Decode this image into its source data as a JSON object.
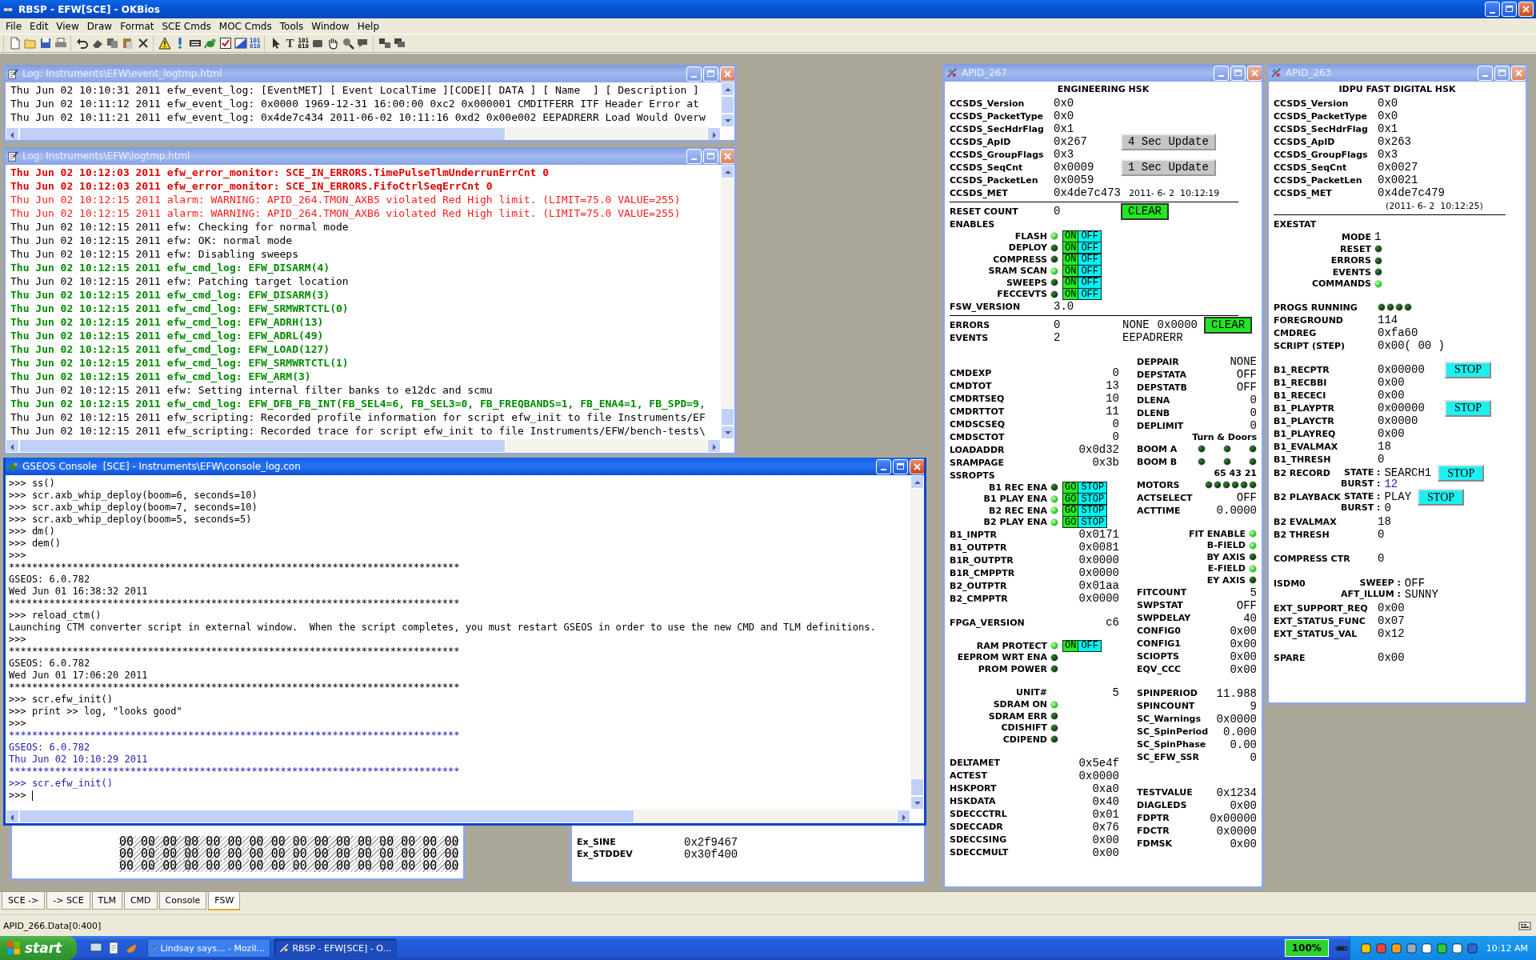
{
  "app_window": {
    "title": "RBSP - EFW[SCE] - OKBios"
  },
  "menu": [
    "File",
    "Edit",
    "View",
    "Draw",
    "Format",
    "SCE Cmds",
    "MOC Cmds",
    "Tools",
    "Window",
    "Help"
  ],
  "toolbar": [
    [
      {
        "kind": "new"
      },
      {
        "kind": "open"
      },
      {
        "kind": "save"
      },
      {
        "kind": "print"
      }
    ],
    [
      {
        "kind": "undo"
      },
      {
        "kind": "eraser"
      },
      {
        "kind": "copy"
      },
      {
        "kind": "paste"
      },
      {
        "kind": "delete"
      }
    ],
    [
      {
        "kind": "warning"
      },
      {
        "kind": "info"
      },
      {
        "kind": "keyboard"
      },
      {
        "kind": "lizard"
      },
      {
        "kind": "checkbox"
      },
      {
        "kind": "chart"
      },
      {
        "kind": "binary_color",
        "label": "101\n010"
      }
    ],
    [
      {
        "kind": "pointer"
      },
      {
        "kind": "text",
        "label": "T"
      },
      {
        "kind": "binary",
        "label": "101\n010"
      },
      {
        "kind": "rectangle"
      },
      {
        "kind": "hand"
      },
      {
        "kind": "zoom"
      },
      {
        "kind": "speech"
      }
    ],
    [
      {
        "kind": "tile"
      },
      {
        "kind": "cascade"
      }
    ]
  ],
  "windows": [
    {
      "kind": "log",
      "title": "Log: Instruments\\EFW\\event_logtmp.html",
      "active": false,
      "lines": [
        {
          "kind": "info",
          "text": "Thu Jun 02 10:10:31 2011 efw_event_log: [EventMET] [ Event LocalTime ][CODE][ DATA ] [ Name  ] [ Description ]"
        },
        {
          "kind": "info",
          "text": "Thu Jun 02 10:11:12 2011 efw_event_log: 0x0000 1969-12-31 16:00:00 0xc2 0x000001 CMDITFERR ITF Header Error at"
        },
        {
          "kind": "info",
          "text": "Thu Jun 02 10:11:21 2011 efw_event_log: 0x4de7c434 2011-06-02 10:11:16 0xd2 0x00e002 EEPADRERR Load Would Overw"
        }
      ]
    },
    {
      "kind": "log",
      "title": "Log: Instruments\\EFW\\logtmp.html",
      "active": false,
      "lines": [
        {
          "kind": "error",
          "text": "Thu Jun 02 10:12:03 2011 efw_error_monitor: SCE_IN_ERRORS.TimePulseTlmUnderrunErrCnt 0"
        },
        {
          "kind": "error",
          "text": "Thu Jun 02 10:12:03 2011 efw_error_monitor: SCE_IN_ERRORS.FifoCtrlSeqErrCnt 0"
        },
        {
          "kind": "alarm",
          "text": "Thu Jun 02 10:12:15 2011 alarm: WARNING: APID_264.TMON_AXB5 violated Red High limit. (LIMIT=75.0 VALUE=255)"
        },
        {
          "kind": "alarm",
          "text": "Thu Jun 02 10:12:15 2011 alarm: WARNING: APID_264.TMON_AXB6 violated Red High limit. (LIMIT=75.0 VALUE=255)"
        },
        {
          "kind": "info",
          "text": "Thu Jun 02 10:12:15 2011 efw: Checking for normal mode"
        },
        {
          "kind": "info",
          "text": "Thu Jun 02 10:12:15 2011 efw: OK: normal mode"
        },
        {
          "kind": "info",
          "text": "Thu Jun 02 10:12:15 2011 efw: Disabling sweeps"
        },
        {
          "kind": "command",
          "text": "Thu Jun 02 10:12:15 2011 efw_cmd_log: EFW_DISARM(4)"
        },
        {
          "kind": "info",
          "text": "Thu Jun 02 10:12:15 2011 efw: Patching target location"
        },
        {
          "kind": "command",
          "text": "Thu Jun 02 10:12:15 2011 efw_cmd_log: EFW_DISARM(3)"
        },
        {
          "kind": "command",
          "text": "Thu Jun 02 10:12:15 2011 efw_cmd_log: EFW_SRMWRTCTL(0)"
        },
        {
          "kind": "command",
          "text": "Thu Jun 02 10:12:15 2011 efw_cmd_log: EFW_ADRH(13)"
        },
        {
          "kind": "command",
          "text": "Thu Jun 02 10:12:15 2011 efw_cmd_log: EFW_ADRL(49)"
        },
        {
          "kind": "command",
          "text": "Thu Jun 02 10:12:15 2011 efw_cmd_log: EFW_LOAD(127)"
        },
        {
          "kind": "command",
          "text": "Thu Jun 02 10:12:15 2011 efw_cmd_log: EFW_SRMWRTCTL(1)"
        },
        {
          "kind": "command",
          "text": "Thu Jun 02 10:12:15 2011 efw_cmd_log: EFW_ARM(3)"
        },
        {
          "kind": "info",
          "text": "Thu Jun 02 10:12:15 2011 efw: Setting internal filter banks to e12dc and scmu"
        },
        {
          "kind": "command",
          "text": "Thu Jun 02 10:12:15 2011 efw_cmd_log: EFW_DFB_FB_INT(FB_SEL4=6, FB_SEL3=0, FB_FREQBANDS=1, FB_ENA4=1, FB_SPD=9,"
        },
        {
          "kind": "info",
          "text": "Thu Jun 02 10:12:15 2011 efw_scripting: Recorded profile information for script efw_init to file Instruments/EF"
        },
        {
          "kind": "info",
          "text": "Thu Jun 02 10:12:15 2011 efw_scripting: Recorded trace for script efw_init to file Instruments/EFW/bench-tests\\"
        }
      ]
    },
    {
      "kind": "console",
      "title": "GSEOS Console  [SCE] - Instruments\\EFW\\console_log.con",
      "active": true,
      "lines": [
        {
          "kind": "output",
          "text": ">>> ss()"
        },
        {
          "kind": "output",
          "text": ">>> scr.axb_whip_deploy(boom=6, seconds=10)"
        },
        {
          "kind": "output",
          "text": ">>> scr.axb_whip_deploy(boom=7, seconds=10)"
        },
        {
          "kind": "output",
          "text": ">>> scr.axb_whip_deploy(boom=5, seconds=5)"
        },
        {
          "kind": "output",
          "text": ">>> dm()"
        },
        {
          "kind": "output",
          "text": ">>> dem()"
        },
        {
          "kind": "output",
          "text": ">>>"
        },
        {
          "kind": "output",
          "text": "******************************************************************************"
        },
        {
          "kind": "output",
          "text": "GSEOS: 6.0.782"
        },
        {
          "kind": "output",
          "text": "Wed Jun 01 16:38:32 2011"
        },
        {
          "kind": "output",
          "text": "******************************************************************************"
        },
        {
          "kind": "output",
          "text": ">>> reload_ctm()"
        },
        {
          "kind": "output",
          "text": "Launching CTM converter script in external window.  When the script completes, you must restart GSEOS in order to use the new CMD and TLM definitions."
        },
        {
          "kind": "output",
          "text": ">>>"
        },
        {
          "kind": "output",
          "text": "******************************************************************************"
        },
        {
          "kind": "output",
          "text": "GSEOS: 6.0.782"
        },
        {
          "kind": "output",
          "text": "Wed Jun 01 17:06:20 2011"
        },
        {
          "kind": "output",
          "text": "******************************************************************************"
        },
        {
          "kind": "output",
          "text": ">>> scr.efw_init()"
        },
        {
          "kind": "output",
          "text": ">>> print >> log, \"looks good\""
        },
        {
          "kind": "output",
          "text": ">>>"
        },
        {
          "kind": "highlight",
          "text": "******************************************************************************"
        },
        {
          "kind": "highlight",
          "text": "GSEOS: 6.0.782"
        },
        {
          "kind": "highlight",
          "text": "Thu Jun 02 10:10:29 2011"
        },
        {
          "kind": "highlight",
          "text": "******************************************************************************"
        },
        {
          "kind": "highlight",
          "text": ">>> scr.efw_init()"
        },
        {
          "kind": "input",
          "text": ">>>"
        }
      ]
    },
    {
      "kind": "hex",
      "rows": [
        "00 00 00 00 00 00 00 00 00 00 00 00 00 00 00 00",
        "00 00 00 00 00 00 00 00 00 00 00 00 00 00 00 00",
        "00 00 00 00 00 00 00 00 00 00 00 00 00 00 00 00"
      ]
    },
    {
      "kind": "values",
      "rows": [
        {
          "label": "Ex_SINE",
          "value": "0x2f9467"
        },
        {
          "label": "Ex_STDDEV",
          "value": "0x30f400"
        }
      ]
    },
    {
      "kind": "hsk",
      "title": "APID_267",
      "active": false,
      "rows": [
        {
          "kind": "title",
          "text": "ENGINEERING HSK"
        },
        {
          "kind": "field",
          "label": "CCSDS_Version",
          "value": "0x0"
        },
        {
          "kind": "field",
          "label": "CCSDS_PacketType",
          "value": "0x0"
        },
        {
          "kind": "field",
          "label": "CCSDS_SecHdrFlag",
          "value": "0x1"
        },
        {
          "kind": "field",
          "label": "CCSDS_ApID",
          "value": "0x267",
          "button": {
            "label": "4 Sec Update",
            "kind": "update"
          }
        },
        {
          "kind": "field",
          "label": "CCSDS_GroupFlags",
          "value": "0x3"
        },
        {
          "kind": "field",
          "label": "CCSDS_SeqCnt",
          "value": "0x0009",
          "button": {
            "label": "1 Sec Update",
            "kind": "update"
          }
        },
        {
          "kind": "field",
          "label": "CCSDS_PacketLen",
          "value": "0x0059"
        },
        {
          "kind": "field",
          "label": "CCSDS_MET",
          "value": "0x4de7c473",
          "note": "2011- 6- 2  10:12:19"
        },
        {
          "kind": "rule"
        },
        {
          "kind": "field",
          "label": "RESET COUNT",
          "value": "0",
          "button": {
            "label": "CLEAR",
            "kind": "clear"
          }
        },
        {
          "kind": "heading",
          "text": "ENABLES"
        },
        {
          "kind": "led",
          "label": "FLASH",
          "on": true,
          "buttons": [
            {
              "label": "ON",
              "kind": "enable"
            },
            {
              "label": "OFF",
              "kind": "disable"
            }
          ]
        },
        {
          "kind": "led",
          "label": "DEPLOY",
          "on": false,
          "buttons": [
            {
              "label": "ON",
              "kind": "enable"
            },
            {
              "label": "OFF",
              "kind": "disable"
            }
          ]
        },
        {
          "kind": "led",
          "label": "COMPRESS",
          "on": false,
          "buttons": [
            {
              "label": "ON",
              "kind": "enable"
            },
            {
              "label": "OFF",
              "kind": "disable"
            }
          ]
        },
        {
          "kind": "led",
          "label": "SRAM SCAN",
          "on": true,
          "buttons": [
            {
              "label": "ON",
              "kind": "enable"
            },
            {
              "label": "OFF",
              "kind": "disable"
            }
          ]
        },
        {
          "kind": "led",
          "label": "SWEEPS",
          "on": false,
          "buttons": [
            {
              "label": "ON",
              "kind": "enable"
            },
            {
              "label": "OFF",
              "kind": "disable"
            }
          ]
        },
        {
          "kind": "led",
          "label": "FECCEVTS",
          "on": false,
          "buttons": [
            {
              "label": "ON",
              "kind": "enable"
            },
            {
              "label": "OFF",
              "kind": "disable"
            }
          ]
        },
        {
          "kind": "field",
          "label": "FSW_VERSION",
          "value": "3.0"
        },
        {
          "kind": "rule"
        },
        {
          "kind": "field",
          "label": "ERRORS",
          "value": "0",
          "extras": [
            "NONE",
            "0x0000"
          ],
          "button": {
            "label": "CLEAR",
            "kind": "clear"
          }
        },
        {
          "kind": "field",
          "label": "EVENTS",
          "value": "2",
          "extras": [
            "EEPADRERR"
          ]
        },
        {
          "kind": "spacer"
        },
        {
          "kind": "columns",
          "left": [
            {
              "kind": "spacer"
            },
            {
              "kind": "field",
              "label": "CMDEXP",
              "value": "0"
            },
            {
              "kind": "field",
              "label": "CMDTOT",
              "value": "13"
            },
            {
              "kind": "field",
              "label": "CMDRTSEQ",
              "value": "10"
            },
            {
              "kind": "field",
              "label": "CMDRTTOT",
              "value": "11"
            },
            {
              "kind": "field",
              "label": "CMDSCSEQ",
              "value": "0"
            },
            {
              "kind": "field",
              "label": "CMDSCTOT",
              "value": "0"
            },
            {
              "kind": "field",
              "label": "LOADADDR",
              "value": "0x0d32"
            },
            {
              "kind": "field",
              "label": "SRAMPAGE",
              "value": "0x3b"
            },
            {
              "kind": "heading",
              "text": "SSROPTS"
            },
            {
              "kind": "led",
              "label": "B1 REC ENA",
              "on": false,
              "buttons": [
                {
                  "label": "GO",
                  "kind": "enable"
                },
                {
                  "label": "STOP",
                  "kind": "disable"
                }
              ]
            },
            {
              "kind": "led",
              "label": "B1 PLAY ENA",
              "on": true,
              "buttons": [
                {
                  "label": "GO",
                  "kind": "enable"
                },
                {
                  "label": "STOP",
                  "kind": "disable"
                }
              ]
            },
            {
              "kind": "led",
              "label": "B2 REC ENA",
              "on": true,
              "buttons": [
                {
                  "label": "GO",
                  "kind": "enable"
                },
                {
                  "label": "STOP",
                  "kind": "disable"
                }
              ]
            },
            {
              "kind": "led",
              "label": "B2 PLAY ENA",
              "on": true,
              "buttons": [
                {
                  "label": "GO",
                  "kind": "enable"
                },
                {
                  "label": "STOP",
                  "kind": "disable"
                }
              ]
            },
            {
              "kind": "field",
              "label": "B1_INPTR",
              "value": "0x0171"
            },
            {
              "kind": "field",
              "label": "B1_OUTPTR",
              "value": "0x0081"
            },
            {
              "kind": "field",
              "label": "B1R_OUTPTR",
              "value": "0x0000"
            },
            {
              "kind": "field",
              "label": "B1R_CMPPTR",
              "value": "0x0000"
            },
            {
              "kind": "field",
              "label": "B2_OUTPTR",
              "value": "0x01aa"
            },
            {
              "kind": "field",
              "label": "B2_CMPPTR",
              "value": "0x0000"
            },
            {
              "kind": "spacer"
            },
            {
              "kind": "field",
              "label": "FPGA_VERSION",
              "value": "c6"
            },
            {
              "kind": "spacer"
            },
            {
              "kind": "led",
              "label": "RAM PROTECT",
              "on": true,
              "buttons": [
                {
                  "label": "ON",
                  "kind": "enable"
                },
                {
                  "label": "OFF",
                  "kind": "disable"
                }
              ]
            },
            {
              "kind": "led",
              "label": "EEPROM WRT ENA",
              "on": false
            },
            {
              "kind": "led",
              "label": "PROM POWER",
              "on": false
            },
            {
              "kind": "spacer"
            },
            {
              "kind": "sub",
              "label": "UNIT#",
              "value": "5"
            },
            {
              "kind": "led",
              "label": "SDRAM ON",
              "on": true
            },
            {
              "kind": "led",
              "label": "SDRAM ERR",
              "on": false
            },
            {
              "kind": "led",
              "label": "CDISHIFT",
              "on": false
            },
            {
              "kind": "led",
              "label": "CDIPEND",
              "on": false
            },
            {
              "kind": "spacer"
            },
            {
              "kind": "field",
              "label": "DELTAMET",
              "value": "0x5e4f"
            },
            {
              "kind": "field",
              "label": "ACTEST",
              "value": "0x0000"
            },
            {
              "kind": "field",
              "label": "HSKPORT",
              "value": "0xa0"
            },
            {
              "kind": "field",
              "label": "HSKDATA",
              "value": "0x40"
            },
            {
              "kind": "field",
              "label": "SDECCCTRL",
              "value": "0x01"
            },
            {
              "kind": "field",
              "label": "SDECCADR",
              "value": "0x76"
            },
            {
              "kind": "field",
              "label": "SDECCSING",
              "value": "0x00"
            },
            {
              "kind": "field",
              "label": "SDECCMULT",
              "value": "0x00"
            }
          ],
          "right": [
            {
              "kind": "field",
              "label": "DEPPAIR",
              "value": "NONE"
            },
            {
              "kind": "field",
              "label": "DEPSTATA",
              "value": "OFF"
            },
            {
              "kind": "field",
              "label": "DEPSTATB",
              "value": "OFF"
            },
            {
              "kind": "field",
              "label": "DLENA",
              "value": "0"
            },
            {
              "kind": "field",
              "label": "DLENB",
              "value": "0"
            },
            {
              "kind": "field",
              "label": "DEPLIMIT",
              "value": "0"
            },
            {
              "kind": "caption",
              "text": "Turn & Doors"
            },
            {
              "kind": "leds",
              "label": "BOOM A",
              "states": [
                false,
                false,
                false
              ]
            },
            {
              "kind": "leds",
              "label": "BOOM B",
              "states": [
                false,
                false,
                false
              ]
            },
            {
              "kind": "caption",
              "text": "65 43 21"
            },
            {
              "kind": "leds",
              "label": "MOTORS",
              "states": [
                false,
                false,
                false,
                false,
                false,
                false
              ]
            },
            {
              "kind": "field",
              "label": "ACTSELECT",
              "value": "OFF"
            },
            {
              "kind": "field",
              "label": "ACTTIME",
              "value": "0.0000"
            },
            {
              "kind": "spacer"
            },
            {
              "kind": "led",
              "label": "FIT ENABLE",
              "on": true
            },
            {
              "kind": "led",
              "label": "B-FIELD",
              "on": true
            },
            {
              "kind": "led",
              "label": "BY AXIS",
              "on": false
            },
            {
              "kind": "led",
              "label": "E-FIELD",
              "on": true
            },
            {
              "kind": "led",
              "label": "EY AXIS",
              "on": false
            },
            {
              "kind": "field",
              "label": "FITCOUNT",
              "value": "5"
            },
            {
              "kind": "field",
              "label": "SWPSTAT",
              "value": "OFF"
            },
            {
              "kind": "field",
              "label": "SWPDELAY",
              "value": "40"
            },
            {
              "kind": "field",
              "label": "CONFIG0",
              "value": "0x00"
            },
            {
              "kind": "field",
              "label": "CONFIG1",
              "value": "0x00"
            },
            {
              "kind": "field",
              "label": "SCIOPTS",
              "value": "0x00"
            },
            {
              "kind": "field",
              "label": "EQV_CCC",
              "value": "0x00"
            },
            {
              "kind": "spacer"
            },
            {
              "kind": "field",
              "label": "SPINPERIOD",
              "value": "11.988"
            },
            {
              "kind": "field",
              "label": "SPINCOUNT",
              "value": "9"
            },
            {
              "kind": "field",
              "label": "SC_Warnings",
              "value": "0x0000"
            },
            {
              "kind": "field",
              "label": "SC_SpinPeriod",
              "value": "0.000"
            },
            {
              "kind": "field",
              "label": "SC_SpinPhase",
              "value": "0.00"
            },
            {
              "kind": "field",
              "label": "SC_EFW_SSR",
              "value": "0"
            },
            {
              "kind": "spacer"
            },
            {
              "kind": "spacer"
            },
            {
              "kind": "field",
              "label": "TESTVALUE",
              "value": "0x1234"
            },
            {
              "kind": "field",
              "label": "DIAGLEDS",
              "value": "0x00"
            },
            {
              "kind": "field",
              "label": "FDPTR",
              "value": "0x00000"
            },
            {
              "kind": "field",
              "label": "FDCTR",
              "value": "0x0000"
            },
            {
              "kind": "field",
              "label": "FDMSK",
              "value": "0x00"
            }
          ]
        }
      ]
    },
    {
      "kind": "hsk",
      "title": "APID_263",
      "active": false,
      "rows": [
        {
          "kind": "title",
          "text": "IDPU FAST DIGITAL HSK"
        },
        {
          "kind": "field",
          "label": "CCSDS_Version",
          "value": "0x0"
        },
        {
          "kind": "field",
          "label": "CCSDS_PacketType",
          "value": "0x0"
        },
        {
          "kind": "field",
          "label": "CCSDS_SecHdrFlag",
          "value": "0x1"
        },
        {
          "kind": "field",
          "label": "CCSDS_ApID",
          "value": "0x263"
        },
        {
          "kind": "field",
          "label": "CCSDS_GroupFlags",
          "value": "0x3"
        },
        {
          "kind": "field",
          "label": "CCSDS_SeqCnt",
          "value": "0x0027"
        },
        {
          "kind": "field",
          "label": "CCSDS_PacketLen",
          "value": "0x0021"
        },
        {
          "kind": "field",
          "label": "CCSDS_MET",
          "value": "0x4de7c479"
        },
        {
          "kind": "note",
          "text": "(2011- 6- 2  10:12:25)"
        },
        {
          "kind": "rule"
        },
        {
          "kind": "heading",
          "text": "EXESTAT"
        },
        {
          "kind": "sub",
          "label": "MODE",
          "value": "1"
        },
        {
          "kind": "led",
          "label": "RESET",
          "on": false
        },
        {
          "kind": "led",
          "label": "ERRORS",
          "on": false
        },
        {
          "kind": "led",
          "label": "EVENTS",
          "on": false
        },
        {
          "kind": "led",
          "label": "COMMANDS",
          "on": true
        },
        {
          "kind": "spacer"
        },
        {
          "kind": "leds",
          "label": "PROGS RUNNING",
          "states": [
            false,
            false,
            false,
            false
          ]
        },
        {
          "kind": "field",
          "label": "FOREGROUND",
          "value": "114"
        },
        {
          "kind": "field",
          "label": "CMDREG",
          "value": "0xfa60"
        },
        {
          "kind": "field",
          "label": "SCRIPT (STEP)",
          "value": "0x00( 00 )"
        },
        {
          "kind": "spacer"
        },
        {
          "kind": "field",
          "label": "B1_RECPTR",
          "value": "0x00000",
          "button": {
            "label": "STOP",
            "kind": "stop"
          }
        },
        {
          "kind": "field",
          "label": "B1_RECBBI",
          "value": "0x00"
        },
        {
          "kind": "field",
          "label": "B1_RECECI",
          "value": "0x00"
        },
        {
          "kind": "field",
          "label": "B1_PLAYPTR",
          "value": "0x00000",
          "button": {
            "label": "STOP",
            "kind": "stop"
          }
        },
        {
          "kind": "field",
          "label": "B1_PLAYCTR",
          "value": "0x0000"
        },
        {
          "kind": "field",
          "label": "B1_PLAYREQ",
          "value": "0x00"
        },
        {
          "kind": "field",
          "label": "B1_EVALMAX",
          "value": "18"
        },
        {
          "kind": "field",
          "label": "B1_THRESH",
          "value": "0"
        },
        {
          "kind": "state",
          "label": "B2 RECORD",
          "pairs": [
            {
              "label": "STATE :",
              "value": "SEARCH1",
              "highlight": false
            },
            {
              "label": "BURST :",
              "value": "12",
              "highlight": true
            }
          ],
          "button": {
            "label": "STOP",
            "kind": "stop"
          }
        },
        {
          "kind": "state",
          "label": "B2 PLAYBACK",
          "pairs": [
            {
              "label": "STATE :",
              "value": "PLAY",
              "highlight": false
            },
            {
              "label": "BURST :",
              "value": "0",
              "highlight": false
            }
          ],
          "button": {
            "label": "STOP",
            "kind": "stop"
          }
        },
        {
          "kind": "field",
          "label": "B2 EVALMAX",
          "value": "18"
        },
        {
          "kind": "field",
          "label": "B2 THRESH",
          "value": "0"
        },
        {
          "kind": "spacer"
        },
        {
          "kind": "field",
          "label": "COMPRESS CTR",
          "value": "0"
        },
        {
          "kind": "spacer"
        },
        {
          "kind": "state",
          "label": "ISDM0",
          "pairs": [
            {
              "label": "SWEEP :",
              "value": "OFF",
              "highlight": false
            },
            {
              "label": "AFT_ILLUM :",
              "value": "SUNNY",
              "highlight": false
            }
          ]
        },
        {
          "kind": "field",
          "label": "EXT_SUPPORT_REQ",
          "value": "0x00"
        },
        {
          "kind": "field",
          "label": "EXT_STATUS_FUNC",
          "value": "0x07"
        },
        {
          "kind": "field",
          "label": "EXT_STATUS_VAL",
          "value": "0x12"
        },
        {
          "kind": "spacer"
        },
        {
          "kind": "field",
          "label": "SPARE",
          "value": "0x00"
        }
      ]
    }
  ],
  "tabs": [
    {
      "label": "SCE ->",
      "selected": false
    },
    {
      "label": "-> SCE",
      "selected": false
    },
    {
      "label": "TLM",
      "selected": false
    },
    {
      "label": "CMD",
      "selected": false
    },
    {
      "label": "Console",
      "selected": false
    },
    {
      "label": "FSW",
      "selected": true
    }
  ],
  "status_bar": {
    "text": "APID_266.Data[0:400]"
  },
  "taskbar": {
    "start": "start",
    "tasks": [
      {
        "label": "Lindsay says... - Mozil...",
        "selected": false
      },
      {
        "label": "RBSP - EFW[SCE] - O...",
        "selected": true
      }
    ],
    "battery": "100%",
    "clock": "10:12 AM"
  }
}
